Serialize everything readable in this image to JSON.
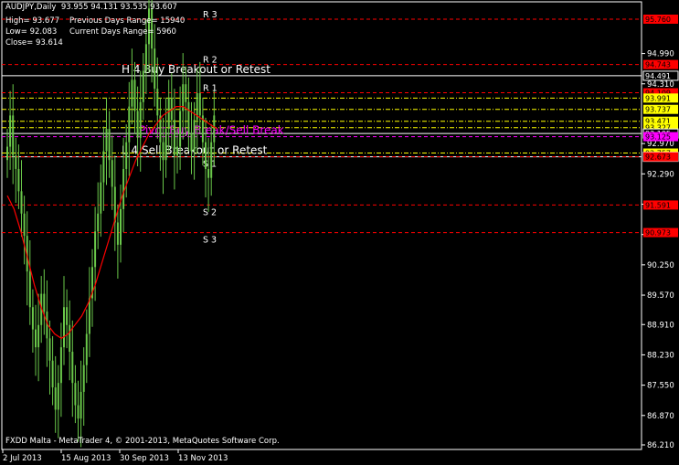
{
  "header": {
    "title": "AUDJPY,Daily  93.955 94.131 93.535 93.607",
    "line_high": "High= 93.677",
    "line_prev_range": "Previous Days Range= 15940",
    "line_low": "Low= 92.083",
    "line_cur_range": "Current Days Range= 5960",
    "line_close": "Close= 93.614"
  },
  "footer": {
    "text": "FXDD Malta - MetaTrader 4, © 2001-2013, MetaQuotes Software Corp."
  },
  "colors": {
    "background": "#000000",
    "bull_candle": "#6ac84a",
    "ma_line": "#ff0000",
    "pivot_line": "#ff00ff",
    "level_red": "#ff0000",
    "level_yellow": "#ffff00",
    "level_white": "#ffffff",
    "axis": "#ffffff"
  },
  "chart_data": {
    "type": "candlestick",
    "symbol": "AUDJPY",
    "timeframe": "Daily",
    "y_ticks": [
      "94.990",
      "94.310",
      "92.970",
      "92.290",
      "91.610",
      "90.930",
      "90.250",
      "89.570",
      "88.910",
      "88.230",
      "87.550",
      "86.870",
      "86.210"
    ],
    "x_ticks": [
      "2 Jul 2013",
      "15 Aug 2013",
      "30 Sep 2013",
      "13 Nov 2013"
    ],
    "levels": [
      {
        "name": "R 3",
        "price": 95.76,
        "label": "95.760",
        "color": "#ff0000",
        "style": "dash"
      },
      {
        "name": "R 2",
        "price": 94.743,
        "label": "94.743",
        "color": "#ff0000",
        "style": "dash"
      },
      {
        "name": "H 4 Buy Breakout or Retest",
        "price": 94.491,
        "label": "94.491",
        "color": "#ffffff",
        "style": "solid"
      },
      {
        "name": "R 1",
        "price": 94.109,
        "label": "94.109",
        "color": "#ff0000",
        "style": "dash"
      },
      {
        "name": "",
        "price": 93.991,
        "label": "93.991",
        "color": "#ffff00",
        "style": "dashdot"
      },
      {
        "name": "",
        "price": 93.737,
        "label": "93.737",
        "color": "#ffff00",
        "style": "dashdot"
      },
      {
        "name": "",
        "price": 93.471,
        "label": "93.471",
        "color": "#ffff00",
        "style": "dashdot"
      },
      {
        "name": "",
        "price": 93.327,
        "label": "93.327",
        "color": "#ffff00",
        "style": "dashdot"
      },
      {
        "name": "",
        "price": 93.195,
        "label": "93.195",
        "color": "#ffffff",
        "style": "solid"
      },
      {
        "name": "Pivot Buy Break/Sell Break",
        "price": 93.125,
        "label": "93.125",
        "color": "#ff00ff",
        "style": "dash"
      },
      {
        "name": "",
        "price": 92.757,
        "label": "92.757",
        "color": "#ffff00",
        "style": "dashdot"
      },
      {
        "name": "L 4 Sell Breakout or Retest",
        "price": 92.673,
        "label": "92.673",
        "color": "#ffffff",
        "style": "solid"
      },
      {
        "name": "S 1",
        "price": 92.673,
        "label": "92.673",
        "color": "#ff0000",
        "style": "dash"
      },
      {
        "name": "S 2",
        "price": 91.591,
        "label": "91.591",
        "color": "#ff0000",
        "style": "dash"
      },
      {
        "name": "S 3",
        "price": 90.973,
        "label": "90.973",
        "color": "#ff0000",
        "style": "dash"
      }
    ],
    "candles_close_approx": [
      92.9,
      93.6,
      92.7,
      92.4,
      91.9,
      91.4,
      90.9,
      90.1,
      89.3,
      88.8,
      88.4,
      88.9,
      89.6,
      89.2,
      88.6,
      88.1,
      87.5,
      87.0,
      87.6,
      88.4,
      89.3,
      88.9,
      88.3,
      87.6,
      87.1,
      86.8,
      87.4,
      88.0,
      88.7,
      89.5,
      90.2,
      91.0,
      91.4,
      92.1,
      92.8,
      93.3,
      92.6,
      92.0,
      91.2,
      90.7,
      91.5,
      92.4,
      93.0,
      93.8,
      94.4,
      93.7,
      93.1,
      93.9,
      94.6,
      95.2,
      96.0,
      95.1,
      94.2,
      93.6,
      93.0,
      92.6,
      93.3,
      94.0,
      93.5,
      92.7,
      92.9,
      93.7,
      94.3,
      93.9,
      93.2,
      92.8,
      93.5,
      94.1,
      93.6,
      93.0,
      92.4,
      92.2,
      93.0,
      93.6
    ],
    "ma_approx": [
      91.8,
      91.5,
      91.0,
      90.4,
      89.8,
      89.3,
      88.9,
      88.7,
      88.6,
      88.7,
      88.9,
      89.1,
      89.4,
      89.8,
      90.3,
      90.8,
      91.3,
      91.8,
      92.2,
      92.6,
      92.9,
      93.2,
      93.4,
      93.6,
      93.7,
      93.8,
      93.8,
      93.7,
      93.6,
      93.5,
      93.4,
      93.3
    ]
  }
}
